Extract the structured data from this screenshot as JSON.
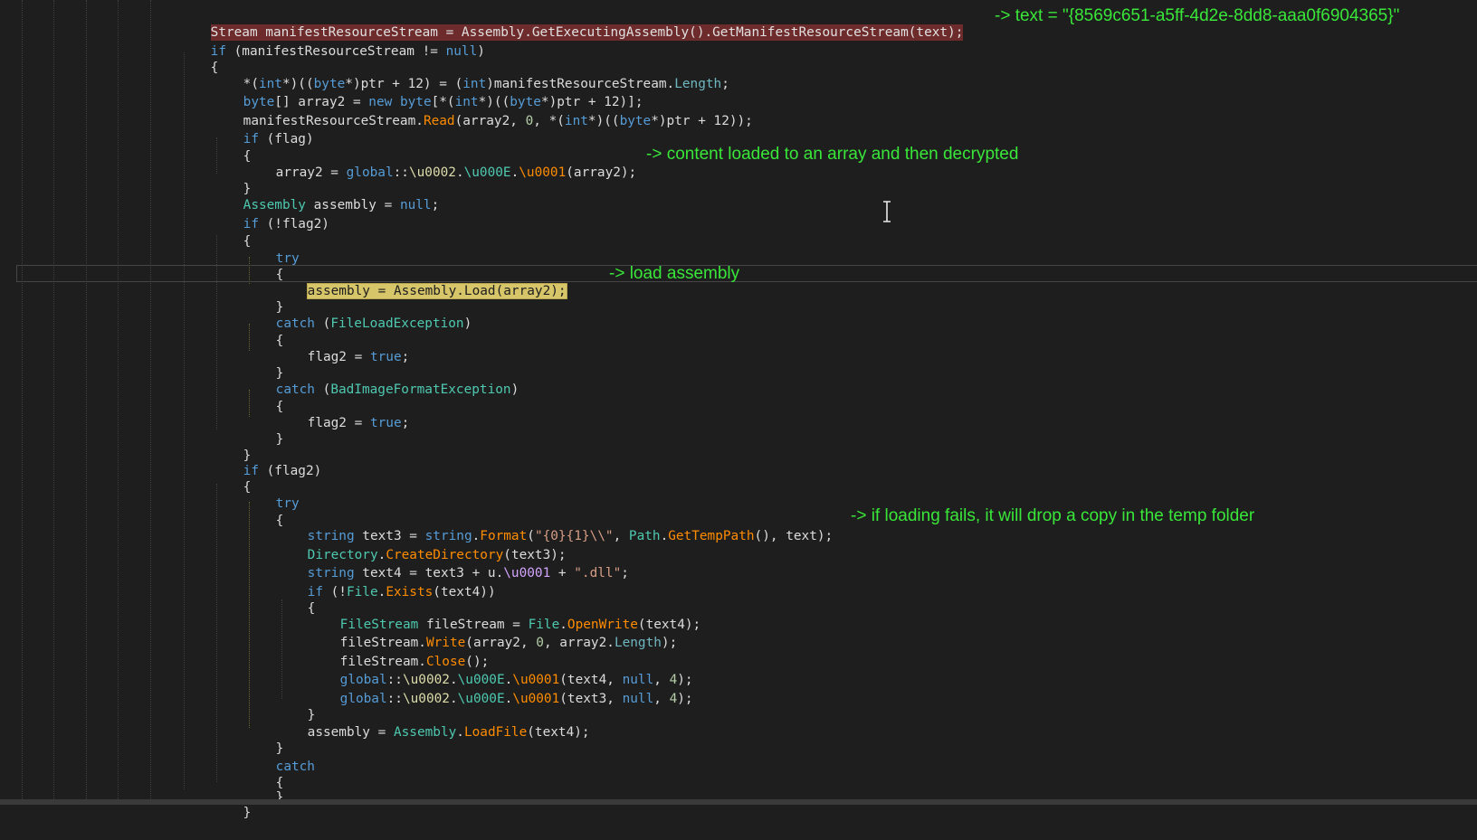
{
  "code": {
    "line0_stream_decl": "Stream manifestResourceStream = Assembly.GetExecutingAssembly().GetManifestResourceStream(text);",
    "line1": [
      "if",
      " (manifestResourceStream != ",
      "null",
      ")"
    ],
    "line2": "{",
    "line3": [
      "*(",
      "int",
      "*)((",
      "byte",
      "*)ptr + 12) = (",
      "int",
      ")manifestResourceStream.",
      "Length",
      ";"
    ],
    "line4": [
      "byte",
      "[] array2 = ",
      "new",
      " ",
      "byte",
      "[*(",
      "int",
      "*)((",
      "byte",
      "*)ptr + 12)];"
    ],
    "line5": [
      "manifestResourceStream.",
      "Read",
      "(array2, ",
      "0",
      ", *(",
      "int",
      "*)((",
      "byte",
      "*)ptr + 12));"
    ],
    "line6": [
      "if",
      " (flag)"
    ],
    "line7": "{",
    "line8": [
      "array2 = ",
      "global",
      "::",
      "\\u0002",
      ".",
      "\\u000E",
      ".",
      "\\u0001",
      "(array2);"
    ],
    "line9": "}",
    "line10": [
      "Assembly",
      " assembly = ",
      "null",
      ";"
    ],
    "line11": [
      "if",
      " (!flag2)"
    ],
    "line12": "{",
    "line13": "try",
    "line14": "{",
    "line15_highlight": "assembly = Assembly.Load(array2);",
    "line16": "}",
    "line17": [
      "catch",
      " (",
      "FileLoadException",
      ")"
    ],
    "line18": "{",
    "line19": [
      "flag2 = ",
      "true",
      ";"
    ],
    "line20": "}",
    "line21": [
      "catch",
      " (",
      "BadImageFormatException",
      ")"
    ],
    "line22": "{",
    "line23": [
      "flag2 = ",
      "true",
      ";"
    ],
    "line24": "}",
    "line25": "}",
    "line26": [
      "if",
      " (flag2)"
    ],
    "line27": "{",
    "line28": "try",
    "line29": "{",
    "line30": [
      "string",
      " text3 = ",
      "string",
      ".",
      "Format",
      "(",
      "\"{0}{1}\\\\\"",
      ", ",
      "Path",
      ".",
      "GetTempPath",
      "(), text);"
    ],
    "line31": [
      "Directory",
      ".",
      "CreateDirectory",
      "(text3);"
    ],
    "line32": [
      "string",
      " text4 = text3 + u.",
      "\\u0001",
      " + ",
      "\".dll\"",
      ";"
    ],
    "line33": [
      "if",
      " (!",
      "File",
      ".",
      "Exists",
      "(text4))"
    ],
    "line34": "{",
    "line35": [
      "FileStream",
      " fileStream = ",
      "File",
      ".",
      "OpenWrite",
      "(text4);"
    ],
    "line36": [
      "fileStream.",
      "Write",
      "(array2, ",
      "0",
      ", array2.",
      "Length",
      ");"
    ],
    "line37": [
      "fileStream.",
      "Close",
      "();"
    ],
    "line38": [
      "global",
      "::",
      "\\u0002",
      ".",
      "\\u000E",
      ".",
      "\\u0001",
      "(text4, ",
      "null",
      ", ",
      "4",
      ");"
    ],
    "line39": [
      "global",
      "::",
      "\\u0002",
      ".",
      "\\u000E",
      ".",
      "\\u0001",
      "(text3, ",
      "null",
      ", ",
      "4",
      ");"
    ],
    "line40": "}",
    "line41": [
      "assembly = ",
      "Assembly",
      ".",
      "LoadFile",
      "(text4);"
    ],
    "line42": "}",
    "line43": "catch",
    "line44": "{",
    "line45": "}",
    "line46": "}"
  },
  "annotations": {
    "text_value": "-> text = \"{8569c651-a5ff-4d2e-8dd8-aaa0f6904365}\"",
    "decrypted": "-> content loaded to an array and then decrypted",
    "load": "-> load assembly",
    "drop": "-> if loading fails, it will drop a copy in the temp folder"
  },
  "colors": {
    "background": "#1e1e1e",
    "keyword": "#569cd6",
    "type": "#4ec9b0",
    "method": "#ff8c00",
    "annotation": "#39e639",
    "red_highlight": "#6e2b2b",
    "yellow_highlight": "#d7c56a"
  },
  "icons": {
    "caret": "text-cursor-ibeam-icon"
  }
}
